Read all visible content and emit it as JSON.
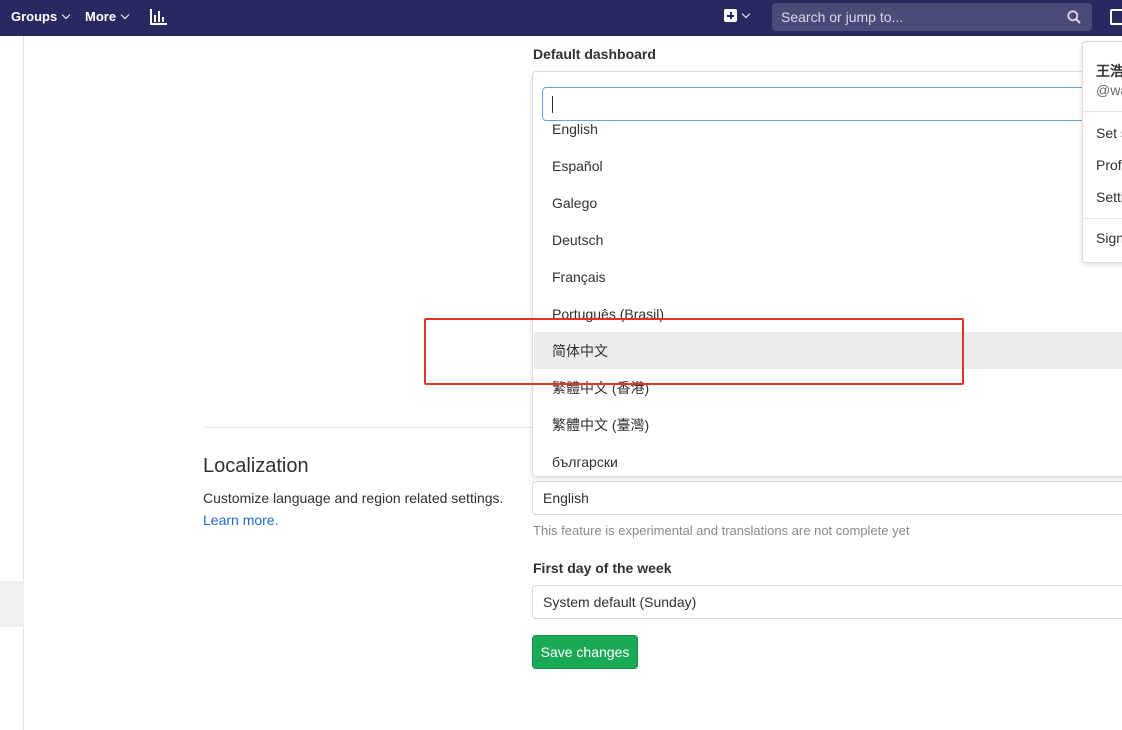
{
  "navbar": {
    "groups_label": "Groups",
    "more_label": "More",
    "search_placeholder": "Search or jump to..."
  },
  "preferences": {
    "default_dashboard_label": "Default dashboard",
    "language_dropdown": {
      "items": [
        {
          "label": "English"
        },
        {
          "label": "Español"
        },
        {
          "label": "Galego"
        },
        {
          "label": "Deutsch"
        },
        {
          "label": "Français"
        },
        {
          "label": "Português (Brasil)"
        },
        {
          "label": "简体中文"
        },
        {
          "label": "繁體中文 (香港)"
        },
        {
          "label": "繁體中文 (臺灣)"
        },
        {
          "label": "български"
        }
      ],
      "highlighted_item": "简体中文"
    },
    "localization": {
      "title": "Localization",
      "description": "Customize language and region related settings.",
      "learn_more": "Learn more.",
      "language_value": "English",
      "language_help": "This feature is experimental and translations are not complete yet",
      "first_day_label": "First day of the week",
      "first_day_value": "System default (Sunday)"
    },
    "save_label": "Save changes"
  },
  "user_menu": {
    "name": "王浩",
    "handle": "@wa",
    "items": [
      {
        "label": "Set s"
      },
      {
        "label": "Prof"
      },
      {
        "label": "Setti"
      },
      {
        "label": "Sign"
      }
    ]
  },
  "colors": {
    "navbar": "#292961",
    "save_button": "#1aaa55",
    "link": "#1f6bcf",
    "annotation": "#e53224"
  }
}
